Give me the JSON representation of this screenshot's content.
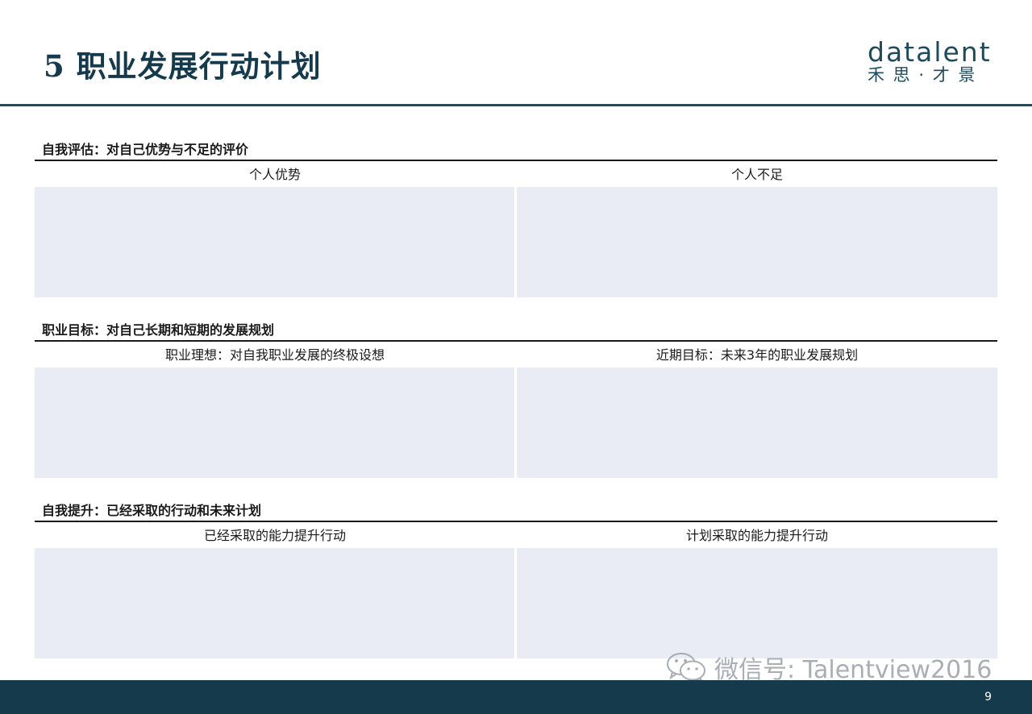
{
  "header": {
    "title": "5 职业发展行动计划",
    "logo_word": "datalent",
    "logo_sub": "禾 思 · 才 景"
  },
  "sections": [
    {
      "title": "自我评估：对自己优势与不足的评价",
      "left_head": "个人优势",
      "right_head": "个人不足"
    },
    {
      "title": "职业目标：对自己长期和短期的发展规划",
      "left_head": "职业理想：对自我职业发展的终极设想",
      "right_head": "近期目标：未来3年的职业发展规划"
    },
    {
      "title": "自我提升：已经采取的行动和未来计划",
      "left_head": "已经采取的能力提升行动",
      "right_head": "计划采取的能力提升行动"
    }
  ],
  "watermark": {
    "icon": "wechat-icon",
    "text": "微信号: Talentview2016"
  },
  "footer": {
    "page_number": "9"
  },
  "colors": {
    "brand": "#153a4c",
    "box_fill": "#e9ebf5"
  }
}
